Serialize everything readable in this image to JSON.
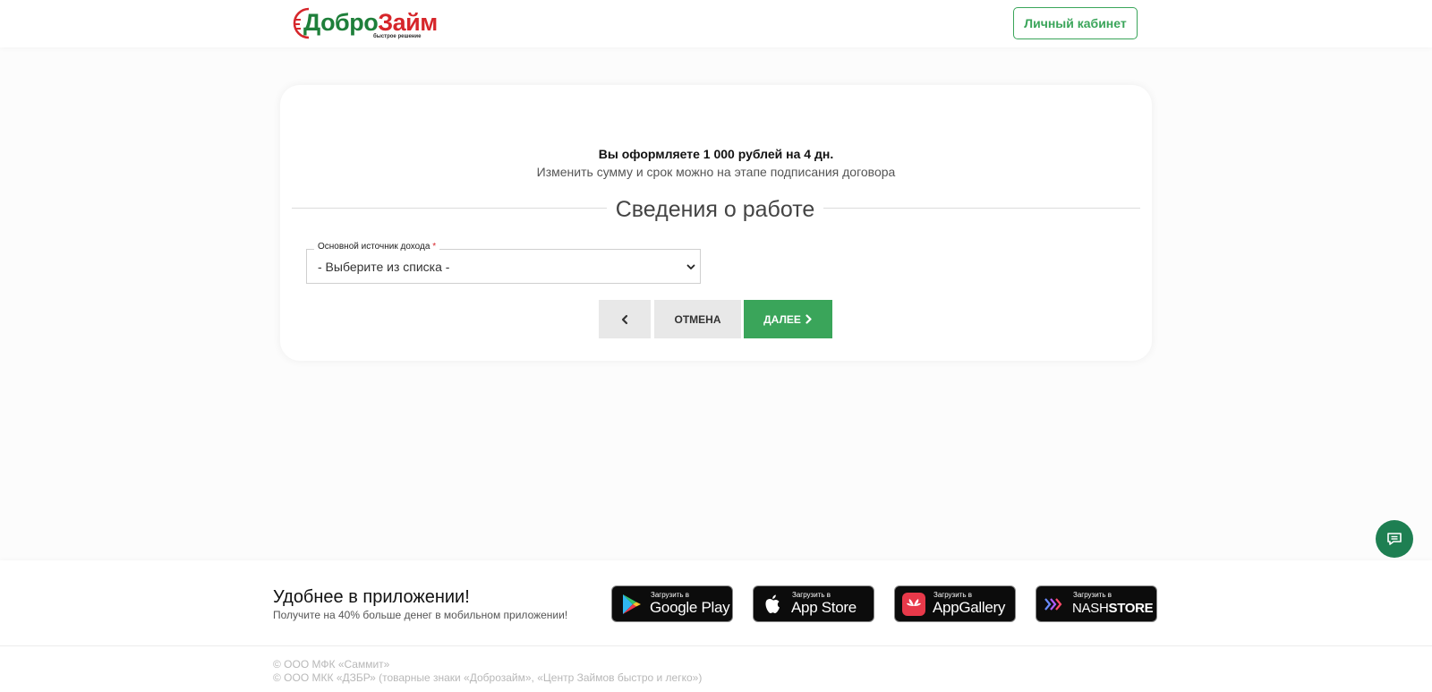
{
  "header": {
    "logo": {
      "part1": "Добро",
      "part2": "Займ",
      "tagline": "быстрое решение"
    },
    "cabinet_label": "Личный кабинет"
  },
  "form": {
    "offer_text": "Вы оформляете 1 000 рублей на 4 дн.",
    "offer_note": "Изменить сумму и срок можно на этапе подписания договора",
    "section_title": "Сведения о работе",
    "income_source": {
      "label": "Основной источник дохода",
      "required_mark": "*",
      "value": "- Выберите из списка -"
    },
    "buttons": {
      "back_icon": "chevron-left-icon",
      "cancel_label": "ОТМЕНА",
      "next_label": "ДАЛЕЕ"
    }
  },
  "footer": {
    "app_title": "Удобнее в приложении!",
    "app_subtitle": "Получите на 40% больше денег в мобильном приложении!",
    "stores": {
      "google": {
        "small": "Загрузить в",
        "big": "Google Play"
      },
      "apple": {
        "small": "Загрузить в",
        "big": "App Store"
      },
      "huawei": {
        "small": "Загрузить в",
        "big": "AppGallery"
      },
      "nash": {
        "small": "Загрузить в",
        "big_light": "NASH",
        "big_bold": "STORE"
      }
    },
    "copyright_1": "© ООО МФК «Саммит»",
    "copyright_2": "© ООО МКК «ДЗБР» (товарные знаки «Доброзайм», «Центр Займов быстро и легко»)"
  },
  "colors": {
    "brand_green": "#3aa55a",
    "brand_dark_green": "#1e7f3a",
    "brand_red": "#d6262b"
  }
}
